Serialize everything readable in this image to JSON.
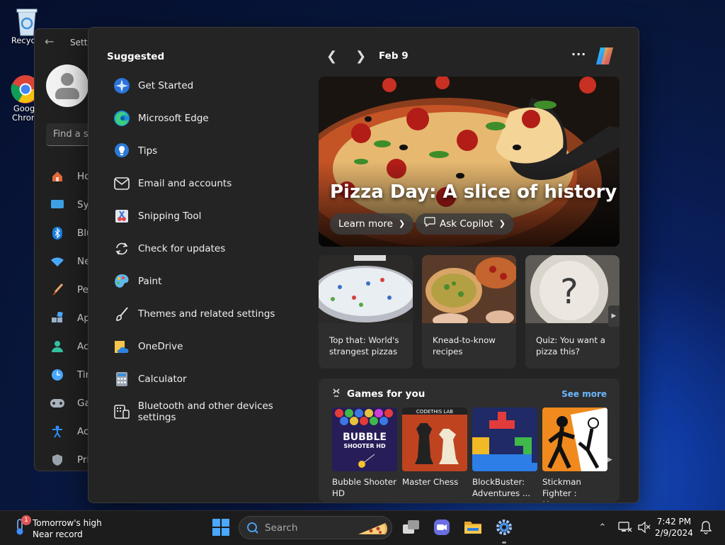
{
  "desktop": {
    "icons": [
      {
        "label": "Recycle"
      },
      {
        "label": "Goog Chron"
      }
    ]
  },
  "settings_window": {
    "title": "Setti",
    "search_placeholder": "Find a se",
    "nav_items": [
      {
        "label": "Ho",
        "icon": "home-icon"
      },
      {
        "label": "Sys",
        "icon": "system-icon"
      },
      {
        "label": "Blu",
        "icon": "bluetooth-icon"
      },
      {
        "label": "Ne",
        "icon": "network-icon"
      },
      {
        "label": "Per",
        "icon": "personalization-icon"
      },
      {
        "label": "Ap",
        "icon": "apps-icon"
      },
      {
        "label": "Acc",
        "icon": "accounts-icon"
      },
      {
        "label": "Tin",
        "icon": "time-icon"
      },
      {
        "label": "Ga",
        "icon": "gaming-icon"
      },
      {
        "label": "Acc",
        "icon": "accessibility-icon"
      },
      {
        "label": "Pri",
        "icon": "privacy-icon"
      }
    ]
  },
  "suggested": {
    "title": "Suggested",
    "items": [
      {
        "label": "Get Started",
        "icon": "get-started-icon"
      },
      {
        "label": "Microsoft Edge",
        "icon": "edge-icon"
      },
      {
        "label": "Tips",
        "icon": "tips-icon"
      },
      {
        "label": "Email and accounts",
        "icon": "mail-icon"
      },
      {
        "label": "Snipping Tool",
        "icon": "snipping-tool-icon"
      },
      {
        "label": "Check for updates",
        "icon": "update-icon"
      },
      {
        "label": "Paint",
        "icon": "paint-icon"
      },
      {
        "label": "Themes and related settings",
        "icon": "brush-icon"
      },
      {
        "label": "OneDrive",
        "icon": "onedrive-icon"
      },
      {
        "label": "Calculator",
        "icon": "calculator-icon"
      },
      {
        "label": "Bluetooth and other devices settings",
        "icon": "devices-icon"
      }
    ]
  },
  "feed": {
    "date": "Feb 9",
    "hero": {
      "headline": "Pizza Day: A slice of history",
      "learn_more": "Learn more",
      "ask_copilot": "Ask Copilot"
    },
    "news": [
      {
        "caption": "Top that: World's strangest pizzas"
      },
      {
        "caption": "Knead-to-know recipes"
      },
      {
        "caption": "Quiz: You want a pizza this?"
      }
    ],
    "games": {
      "title": "Games for you",
      "see_more": "See more",
      "items": [
        {
          "name": "Bubble Shooter HD",
          "tile_text": "BUBBLE SHOOTER HD"
        },
        {
          "name": "Master Chess",
          "tile_text": "CODETHIS LAB"
        },
        {
          "name": "BlockBuster: Adventures ...",
          "tile_text": ""
        },
        {
          "name": "Stickman Fighter : Mega...",
          "tile_text": ""
        }
      ]
    }
  },
  "taskbar": {
    "weather_line1": "Tomorrow's high",
    "weather_line2": "Near record",
    "weather_badge": "1",
    "search_placeholder": "Search",
    "time": "7:42 PM",
    "date": "2/9/2024"
  },
  "colors": {
    "accent_link": "#6cb8ff",
    "flyout_bg": "#242424",
    "card_bg": "#2e2e2e"
  }
}
